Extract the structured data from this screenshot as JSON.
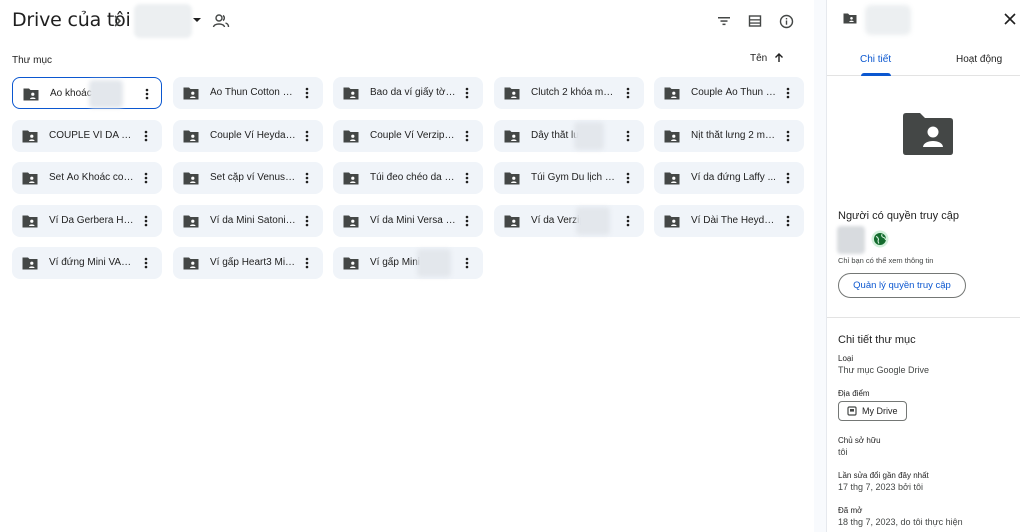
{
  "header": {
    "title": "Drive của tôi",
    "crumb_sep": ">"
  },
  "section": {
    "label": "Thư mục",
    "sort_label": "Tên"
  },
  "folders": [
    {
      "name": "Áo khoác",
      "selected": true
    },
    {
      "name": "Áo Thun Cotton H...",
      "selected": false
    },
    {
      "name": "Bao da ví giấy tờ ...",
      "selected": false
    },
    {
      "name": "Clutch 2 khóa mã ...",
      "selected": false
    },
    {
      "name": "Couple Áo Thun C...",
      "selected": false
    },
    {
      "name": "COUPLE VÍ DA VE...",
      "selected": false
    },
    {
      "name": "Couple Ví Heyday...",
      "selected": false
    },
    {
      "name": "Couple Ví Verzip2 ...",
      "selected": false
    },
    {
      "name": "Dây thắt lưng",
      "selected": false
    },
    {
      "name": "Nịt thắt lưng 2 mặ...",
      "selected": false
    },
    {
      "name": "Set Áo Khoác cou...",
      "selected": false
    },
    {
      "name": "Set cặp ví Venus2...",
      "selected": false
    },
    {
      "name": "Túi đeo chéo da b...",
      "selected": false
    },
    {
      "name": "Túi Gym Du lịch Fi...",
      "selected": false
    },
    {
      "name": "Ví da đứng Laffy ...",
      "selected": false
    },
    {
      "name": "Ví Da Gerbera Ha...",
      "selected": false
    },
    {
      "name": "Ví da Mini Satoni ...",
      "selected": false
    },
    {
      "name": "Ví da Mini Versa H...",
      "selected": false
    },
    {
      "name": "Ví da Verzip2",
      "selected": false
    },
    {
      "name": "Ví Dài The Heyday...",
      "selected": false
    },
    {
      "name": "Ví đứng Mini VAMI...",
      "selected": false
    },
    {
      "name": "Ví gấp Heart3 Min...",
      "selected": false
    },
    {
      "name": "Ví gấp Mini",
      "selected": false
    }
  ],
  "panel": {
    "tab_details": "Chi tiết",
    "tab_activity": "Hoạt động",
    "access_title": "Người có quyền truy cập",
    "view_note": "Chỉ bạn có thể xem thông tin",
    "manage_access": "Quản lý quyền truy cập",
    "details_title": "Chi tiết thư mục",
    "type_label": "Loại",
    "type_value": "Thư mục Google Drive",
    "location_label": "Địa điểm",
    "location_value": "My Drive",
    "owner_label": "Chủ sở hữu",
    "owner_value": "tôi",
    "modified_label": "Lần sửa đổi gần đây nhất",
    "modified_value": "17 thg 7, 2023 bởi tôi",
    "opened_label": "Đã mở",
    "opened_value": "18 thg 7, 2023, do tôi thực hiện"
  },
  "colors": {
    "accent": "#0b57d0",
    "card_bg": "#f0f4f9",
    "icon": "#444746"
  }
}
